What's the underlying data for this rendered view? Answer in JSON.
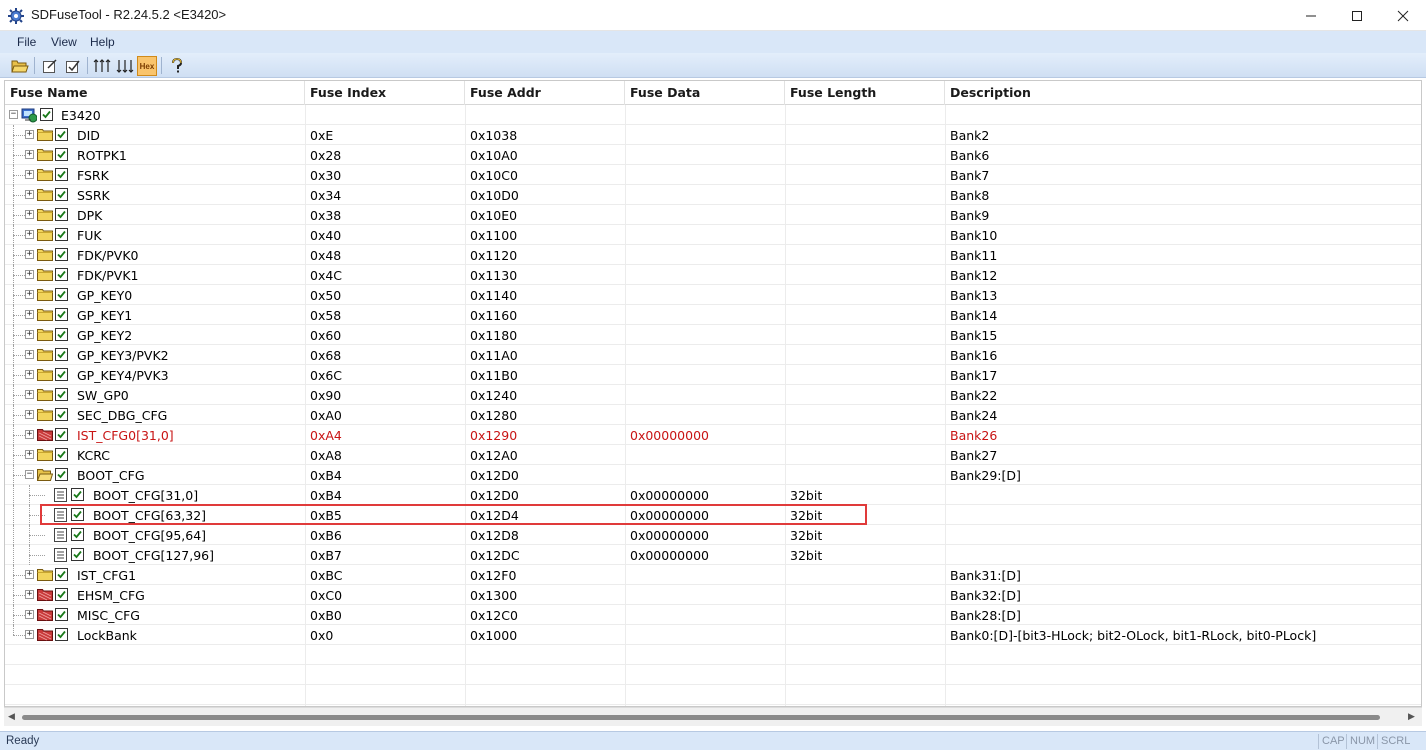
{
  "window": {
    "title": "SDFuseTool - R2.24.5.2 <E3420>",
    "app_icon": "gear-icon",
    "controls": [
      "minimize-icon",
      "maximize-icon",
      "close-icon"
    ]
  },
  "menu": {
    "items": [
      {
        "label": "File"
      },
      {
        "label": "View"
      },
      {
        "label": "Help"
      }
    ]
  },
  "toolbar": {
    "buttons": [
      {
        "icon": "open-folder-icon"
      },
      {
        "icon": "edit-icon"
      },
      {
        "icon": "check-icon"
      },
      {
        "icon": "sort-ascending-icon"
      },
      {
        "icon": "sort-descending-icon"
      },
      {
        "icon": "hex-toggle-icon",
        "label": "Hex"
      },
      {
        "icon": "help-icon"
      }
    ]
  },
  "grid": {
    "columns": [
      {
        "label": "Fuse Name"
      },
      {
        "label": "Fuse Index"
      },
      {
        "label": "Fuse Addr"
      },
      {
        "label": "Fuse Data"
      },
      {
        "label": "Fuse Length"
      },
      {
        "label": "Description"
      }
    ],
    "colors": {
      "error": "#c81414",
      "highlight_border": "#e03a3a",
      "folder": "#f2d45c",
      "red_folder": "#c83a3a"
    },
    "rows": [
      {
        "name": "E3420",
        "index": "",
        "addr": "",
        "data": "",
        "length": "",
        "desc": "",
        "level": 0,
        "type": "root",
        "expander": "−"
      },
      {
        "name": "DID",
        "index": "0xE",
        "addr": "0x1038",
        "data": "",
        "length": "",
        "desc": "Bank2",
        "level": 1,
        "type": "folder",
        "expander": "+"
      },
      {
        "name": "ROTPK1",
        "index": "0x28",
        "addr": "0x10A0",
        "data": "",
        "length": "",
        "desc": "Bank6",
        "level": 1,
        "type": "folder",
        "expander": "+"
      },
      {
        "name": "FSRK",
        "index": "0x30",
        "addr": "0x10C0",
        "data": "",
        "length": "",
        "desc": "Bank7",
        "level": 1,
        "type": "folder",
        "expander": "+"
      },
      {
        "name": "SSRK",
        "index": "0x34",
        "addr": "0x10D0",
        "data": "",
        "length": "",
        "desc": "Bank8",
        "level": 1,
        "type": "folder",
        "expander": "+"
      },
      {
        "name": "DPK",
        "index": "0x38",
        "addr": "0x10E0",
        "data": "",
        "length": "",
        "desc": "Bank9",
        "level": 1,
        "type": "folder",
        "expander": "+"
      },
      {
        "name": "FUK",
        "index": "0x40",
        "addr": "0x1100",
        "data": "",
        "length": "",
        "desc": "Bank10",
        "level": 1,
        "type": "folder",
        "expander": "+"
      },
      {
        "name": "FDK/PVK0",
        "index": "0x48",
        "addr": "0x1120",
        "data": "",
        "length": "",
        "desc": "Bank11",
        "level": 1,
        "type": "folder",
        "expander": "+"
      },
      {
        "name": "FDK/PVK1",
        "index": "0x4C",
        "addr": "0x1130",
        "data": "",
        "length": "",
        "desc": "Bank12",
        "level": 1,
        "type": "folder",
        "expander": "+"
      },
      {
        "name": "GP_KEY0",
        "index": "0x50",
        "addr": "0x1140",
        "data": "",
        "length": "",
        "desc": "Bank13",
        "level": 1,
        "type": "folder",
        "expander": "+"
      },
      {
        "name": "GP_KEY1",
        "index": "0x58",
        "addr": "0x1160",
        "data": "",
        "length": "",
        "desc": "Bank14",
        "level": 1,
        "type": "folder",
        "expander": "+"
      },
      {
        "name": "GP_KEY2",
        "index": "0x60",
        "addr": "0x1180",
        "data": "",
        "length": "",
        "desc": "Bank15",
        "level": 1,
        "type": "folder",
        "expander": "+"
      },
      {
        "name": "GP_KEY3/PVK2",
        "index": "0x68",
        "addr": "0x11A0",
        "data": "",
        "length": "",
        "desc": "Bank16",
        "level": 1,
        "type": "folder",
        "expander": "+"
      },
      {
        "name": "GP_KEY4/PVK3",
        "index": "0x6C",
        "addr": "0x11B0",
        "data": "",
        "length": "",
        "desc": "Bank17",
        "level": 1,
        "type": "folder",
        "expander": "+"
      },
      {
        "name": "SW_GP0",
        "index": "0x90",
        "addr": "0x1240",
        "data": "",
        "length": "",
        "desc": "Bank22",
        "level": 1,
        "type": "folder",
        "expander": "+"
      },
      {
        "name": "SEC_DBG_CFG",
        "index": "0xA0",
        "addr": "0x1280",
        "data": "",
        "length": "",
        "desc": "Bank24",
        "level": 1,
        "type": "folder",
        "expander": "+"
      },
      {
        "name": "IST_CFG0[31,0]",
        "index": "0xA4",
        "addr": "0x1290",
        "data": "0x00000000",
        "length": "",
        "desc": "Bank26",
        "level": 1,
        "type": "red-folder",
        "expander": "+",
        "error": true
      },
      {
        "name": "KCRC",
        "index": "0xA8",
        "addr": "0x12A0",
        "data": "",
        "length": "",
        "desc": "Bank27",
        "level": 1,
        "type": "folder",
        "expander": "+"
      },
      {
        "name": "BOOT_CFG",
        "index": "0xB4",
        "addr": "0x12D0",
        "data": "",
        "length": "",
        "desc": "Bank29:[D]",
        "level": 1,
        "type": "open-folder",
        "expander": "−"
      },
      {
        "name": "BOOT_CFG[31,0]",
        "index": "0xB4",
        "addr": "0x12D0",
        "data": "0x00000000",
        "length": "32bit",
        "desc": "",
        "level": 2,
        "type": "doc",
        "expander": ""
      },
      {
        "name": "BOOT_CFG[63,32]",
        "index": "0xB5",
        "addr": "0x12D4",
        "data": "0x00000000",
        "length": "32bit",
        "desc": "",
        "level": 2,
        "type": "doc",
        "expander": "",
        "highlighted": true
      },
      {
        "name": "BOOT_CFG[95,64]",
        "index": "0xB6",
        "addr": "0x12D8",
        "data": "0x00000000",
        "length": "32bit",
        "desc": "",
        "level": 2,
        "type": "doc",
        "expander": ""
      },
      {
        "name": "BOOT_CFG[127,96]",
        "index": "0xB7",
        "addr": "0x12DC",
        "data": "0x00000000",
        "length": "32bit",
        "desc": "",
        "level": 2,
        "type": "doc",
        "expander": ""
      },
      {
        "name": "IST_CFG1",
        "index": "0xBC",
        "addr": "0x12F0",
        "data": "",
        "length": "",
        "desc": "Bank31:[D]",
        "level": 1,
        "type": "folder",
        "expander": "+"
      },
      {
        "name": "EHSM_CFG",
        "index": "0xC0",
        "addr": "0x1300",
        "data": "",
        "length": "",
        "desc": "Bank32:[D]",
        "level": 1,
        "type": "red-folder",
        "expander": "+"
      },
      {
        "name": "MISC_CFG",
        "index": "0xB0",
        "addr": "0x12C0",
        "data": "",
        "length": "",
        "desc": "Bank28:[D]",
        "level": 1,
        "type": "red-folder",
        "expander": "+"
      },
      {
        "name": "LockBank",
        "index": "0x0",
        "addr": "0x1000",
        "data": "",
        "length": "",
        "desc": "Bank0:[D]-[bit3-HLock; bit2-OLock, bit1-RLock, bit0-PLock]",
        "level": 1,
        "type": "red-folder",
        "expander": "+"
      }
    ]
  },
  "status": {
    "text": "Ready",
    "indicators": [
      "CAP",
      "NUM",
      "SCRL"
    ]
  }
}
